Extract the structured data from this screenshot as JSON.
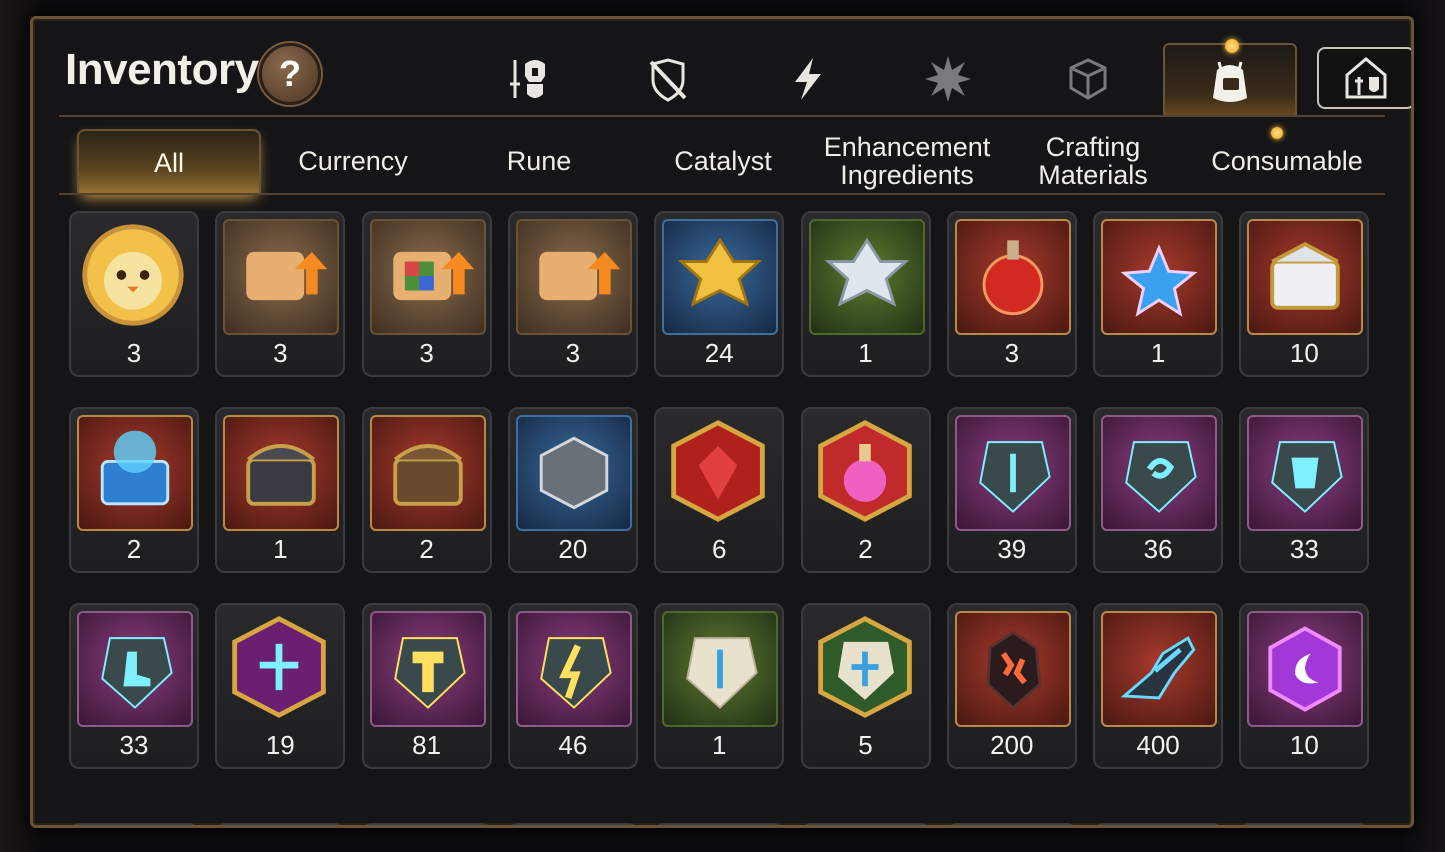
{
  "window": {
    "title": "Inventory",
    "help_label": "?"
  },
  "category_tabs": [
    {
      "icon": "sword-helmet-icon",
      "active": false
    },
    {
      "icon": "shield-crossed-icon",
      "active": false
    },
    {
      "icon": "lightning-icon",
      "active": false
    },
    {
      "icon": "burst-icon",
      "active": false
    },
    {
      "icon": "cube-icon",
      "active": false
    },
    {
      "icon": "backpack-icon",
      "active": true,
      "notification": true
    },
    {
      "icon": "guild-house-icon",
      "active": false
    }
  ],
  "sub_tabs": {
    "all": "All",
    "currency": "Currency",
    "rune": "Rune",
    "catalyst": "Catalyst",
    "enhancement": "Enhancement Ingredients",
    "crafting": "Crafting Materials",
    "consumable": "Consumable",
    "active": "All"
  },
  "items": [
    {
      "icon": "chick-avatar-icon",
      "count": "3"
    },
    {
      "icon": "scroll-upgrade-icon",
      "count": "3"
    },
    {
      "icon": "rainbow-scroll-upgrade-icon",
      "count": "3"
    },
    {
      "icon": "scroll-upgrade-icon",
      "count": "3"
    },
    {
      "icon": "gold-crystal-flower-icon",
      "count": "24"
    },
    {
      "icon": "silver-crystal-flower-icon",
      "count": "1"
    },
    {
      "icon": "red-potion-icon",
      "count": "3"
    },
    {
      "icon": "star-potion-icon",
      "count": "1"
    },
    {
      "icon": "gold-white-chest-icon",
      "count": "10"
    },
    {
      "icon": "blue-chest-icon",
      "count": "2"
    },
    {
      "icon": "dark-chest-icon",
      "count": "1"
    },
    {
      "icon": "wooden-chest-icon",
      "count": "2"
    },
    {
      "icon": "gray-cube-icon",
      "count": "20"
    },
    {
      "icon": "red-gem-hex-icon",
      "count": "6"
    },
    {
      "icon": "pink-potion-hex-icon",
      "count": "2"
    },
    {
      "icon": "rune-sword-icon",
      "count": "39"
    },
    {
      "icon": "rune-swirl-icon",
      "count": "36"
    },
    {
      "icon": "rune-armor-icon",
      "count": "33"
    },
    {
      "icon": "rune-boot-icon",
      "count": "33"
    },
    {
      "icon": "rune-cross-hex-icon",
      "count": "19"
    },
    {
      "icon": "rune-hammer-icon",
      "count": "81"
    },
    {
      "icon": "rune-bolt-icon",
      "count": "46"
    },
    {
      "icon": "stone-sword-icon",
      "count": "1"
    },
    {
      "icon": "stone-cross-hex-icon",
      "count": "5"
    },
    {
      "icon": "red-ore-icon",
      "count": "200"
    },
    {
      "icon": "blue-ore-icon",
      "count": "400"
    },
    {
      "icon": "purple-moon-gem-icon",
      "count": "10"
    }
  ],
  "colors": {
    "accent_gold": "#d7a348",
    "panel_border": "#6a5438",
    "text": "#f0ede8"
  }
}
